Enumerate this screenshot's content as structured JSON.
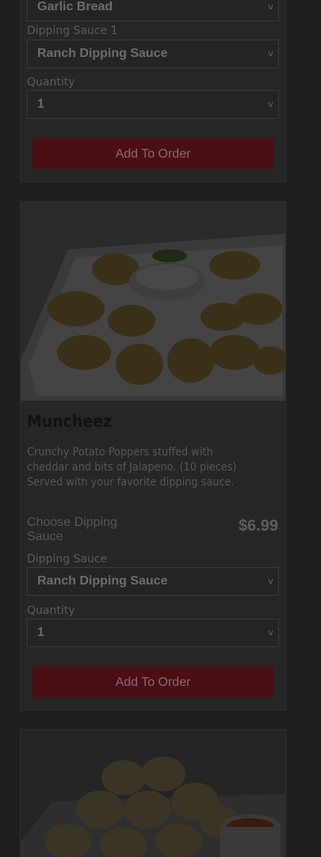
{
  "card1": {
    "side_select_value": "Garlic Bread",
    "sauce_label": "Dipping Sauce 1",
    "sauce_value": "Ranch Dipping Sauce",
    "qty_label": "Quantity",
    "qty_value": "1",
    "add_label": "Add To Order"
  },
  "card2": {
    "title": "Muncheez",
    "description": "Crunchy Potato Poppers stuffed with cheddar and bits of Jalapeno. (10 pieces) Served with your favorite dipping sauce.",
    "choose_label": "Choose Dipping Sauce",
    "price": "$6.99",
    "sauce_label": "Dipping Sauce",
    "sauce_value": "Ranch Dipping Sauce",
    "qty_label": "Quantity",
    "qty_value": "1",
    "add_label": "Add To Order"
  },
  "icons": {
    "dropdown": "chevron-down-icon"
  },
  "colors": {
    "button": "#4a0f14",
    "overlay": "#1f1f1f"
  }
}
